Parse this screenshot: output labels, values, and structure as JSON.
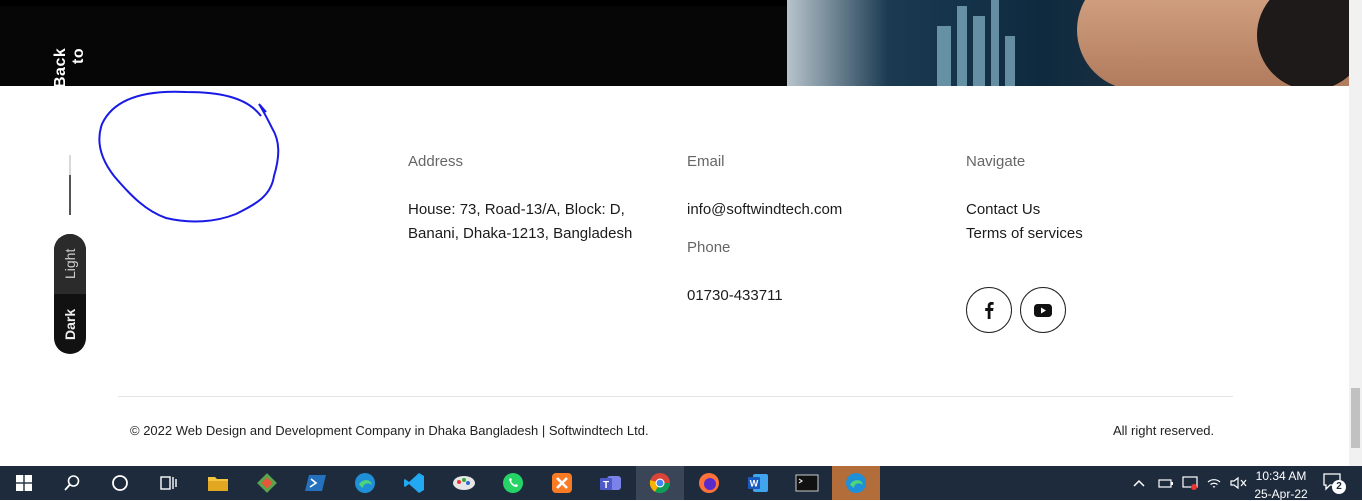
{
  "side": {
    "back_to_top": "Back to top",
    "theme_light": "Light",
    "theme_dark": "Dark",
    "scroll_progress": 0.67
  },
  "footer": {
    "address": {
      "heading": "Address",
      "lines": [
        "House: 73, Road-13/A, Block: D,",
        "Banani, Dhaka-1213, Bangladesh"
      ]
    },
    "email": {
      "heading": "Email",
      "value": "info@softwindtech.com"
    },
    "phone": {
      "heading": "Phone",
      "value": "01730-433711"
    },
    "navigate": {
      "heading": "Navigate",
      "links": [
        "Contact Us",
        "Terms of services"
      ]
    },
    "socials": [
      "facebook-icon",
      "youtube-icon"
    ],
    "copyright": "© 2022 Web Design and Development Company in Dhaka Bangladesh | Softwindtech Ltd.",
    "rights": "All right reserved."
  },
  "taskbar": {
    "apps": [
      "windows-start-icon",
      "search-icon",
      "cortana-icon",
      "task-view-icon",
      "file-explorer-icon",
      "git-icon",
      "powershell-icon",
      "edge-icon",
      "vscode-icon",
      "paint-icon",
      "whatsapp-icon",
      "xampp-icon",
      "teams-icon",
      "chrome-icon",
      "firefox-icon",
      "word-icon",
      "terminal-icon",
      "edge-dev-icon"
    ],
    "time": "10:34 AM",
    "date": "25-Apr-22",
    "notifications": "2"
  },
  "colors": {
    "taskbar_bg": "#1d2b3d",
    "annotation": "#1a1ae6"
  }
}
